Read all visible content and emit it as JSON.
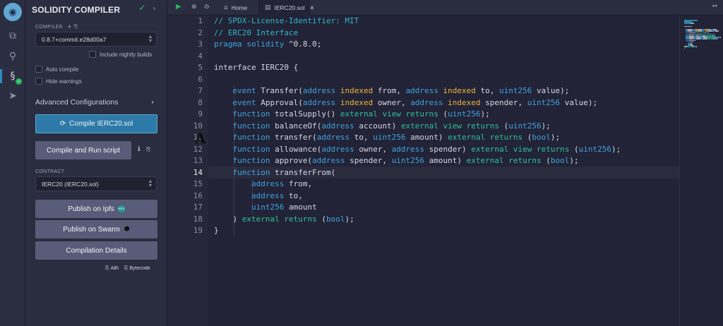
{
  "rail": {
    "icons": [
      "remix-logo-icon",
      "file-explorer-icon",
      "search-icon",
      "solidity-compiler-icon",
      "deploy-run-icon"
    ]
  },
  "panel": {
    "title": "SOLIDITY COMPILER",
    "compiler_label": "COMPILER",
    "compiler_version": "0.8.7+commit.e28d00a7",
    "include_nightly": "Include nightly builds",
    "auto_compile": "Auto compile",
    "hide_warnings": "Hide warnings",
    "advanced": "Advanced Configurations",
    "compile_button": "Compile IERC20.sol",
    "compile_run_button": "Compile and Run script",
    "contract_label": "CONTRACT",
    "contract_value": "IERC20 (IERC20.sol)",
    "publish_ipfs": "Publish on Ipfs",
    "ipfs_badge": "IPFS",
    "publish_swarm": "Publish on Swarm",
    "compilation_details": "Compilation Details",
    "abi_link": "ABI",
    "bytecode_link": "Bytecode"
  },
  "tabs": {
    "home": "Home",
    "file": "IERC20.sol"
  },
  "figure_letter": "A",
  "editor": {
    "current_line": 14,
    "line_numbers": [
      "1",
      "2",
      "3",
      "4",
      "5",
      "6",
      "7",
      "8",
      "9",
      "10",
      "11",
      "12",
      "13",
      "14",
      "15",
      "16",
      "17",
      "18",
      "19"
    ],
    "colors": {
      "comment": "#2fb6c7",
      "keyword": "#3fa3e0",
      "modifier": "#2fc19b",
      "indexed": "#e8b63e",
      "plain": "#d5d7e2"
    },
    "lines": [
      [
        {
          "t": "// SPDX-License-Identifier: MIT",
          "c": "com"
        }
      ],
      [
        {
          "t": "// ERC20 Interface",
          "c": "com"
        }
      ],
      [
        {
          "t": "pragma solidity",
          "c": "kw"
        },
        {
          "t": " ^0.8.0;",
          "c": "pl"
        }
      ],
      [],
      [
        {
          "t": "interface IERC20 {",
          "c": "pl"
        }
      ],
      [],
      [
        {
          "t": "    ",
          "c": "pl"
        },
        {
          "t": "event",
          "c": "kw"
        },
        {
          "t": " Transfer(",
          "c": "pl"
        },
        {
          "t": "address",
          "c": "kw"
        },
        {
          "t": " ",
          "c": "pl"
        },
        {
          "t": "indexed",
          "c": "idx"
        },
        {
          "t": " from, ",
          "c": "pl"
        },
        {
          "t": "address",
          "c": "kw"
        },
        {
          "t": " ",
          "c": "pl"
        },
        {
          "t": "indexed",
          "c": "idx"
        },
        {
          "t": " to, ",
          "c": "pl"
        },
        {
          "t": "uint256",
          "c": "kw"
        },
        {
          "t": " value);",
          "c": "pl"
        }
      ],
      [
        {
          "t": "    ",
          "c": "pl"
        },
        {
          "t": "event",
          "c": "kw"
        },
        {
          "t": " Approval(",
          "c": "pl"
        },
        {
          "t": "address",
          "c": "kw"
        },
        {
          "t": " ",
          "c": "pl"
        },
        {
          "t": "indexed",
          "c": "idx"
        },
        {
          "t": " owner, ",
          "c": "pl"
        },
        {
          "t": "address",
          "c": "kw"
        },
        {
          "t": " ",
          "c": "pl"
        },
        {
          "t": "indexed",
          "c": "idx"
        },
        {
          "t": " spender, ",
          "c": "pl"
        },
        {
          "t": "uint256",
          "c": "kw"
        },
        {
          "t": " value);",
          "c": "pl"
        }
      ],
      [
        {
          "t": "    ",
          "c": "pl"
        },
        {
          "t": "function",
          "c": "kw"
        },
        {
          "t": " totalSupply() ",
          "c": "pl"
        },
        {
          "t": "external",
          "c": "ext"
        },
        {
          "t": " ",
          "c": "pl"
        },
        {
          "t": "view",
          "c": "ext"
        },
        {
          "t": " ",
          "c": "pl"
        },
        {
          "t": "returns",
          "c": "ext"
        },
        {
          "t": " (",
          "c": "pl"
        },
        {
          "t": "uint256",
          "c": "kw"
        },
        {
          "t": ");",
          "c": "pl"
        }
      ],
      [
        {
          "t": "    ",
          "c": "pl"
        },
        {
          "t": "function",
          "c": "kw"
        },
        {
          "t": " balanceOf(",
          "c": "pl"
        },
        {
          "t": "address",
          "c": "kw"
        },
        {
          "t": " account) ",
          "c": "pl"
        },
        {
          "t": "external",
          "c": "ext"
        },
        {
          "t": " ",
          "c": "pl"
        },
        {
          "t": "view",
          "c": "ext"
        },
        {
          "t": " ",
          "c": "pl"
        },
        {
          "t": "returns",
          "c": "ext"
        },
        {
          "t": " (",
          "c": "pl"
        },
        {
          "t": "uint256",
          "c": "kw"
        },
        {
          "t": ");",
          "c": "pl"
        }
      ],
      [
        {
          "t": "    ",
          "c": "pl"
        },
        {
          "t": "function",
          "c": "kw"
        },
        {
          "t": " transfer(",
          "c": "pl"
        },
        {
          "t": "address",
          "c": "kw"
        },
        {
          "t": " to, ",
          "c": "pl"
        },
        {
          "t": "uint256",
          "c": "kw"
        },
        {
          "t": " amount) ",
          "c": "pl"
        },
        {
          "t": "external",
          "c": "ext"
        },
        {
          "t": " ",
          "c": "pl"
        },
        {
          "t": "returns",
          "c": "ext"
        },
        {
          "t": " (",
          "c": "pl"
        },
        {
          "t": "bool",
          "c": "kw"
        },
        {
          "t": ");",
          "c": "pl"
        }
      ],
      [
        {
          "t": "    ",
          "c": "pl"
        },
        {
          "t": "function",
          "c": "kw"
        },
        {
          "t": " allowance(",
          "c": "pl"
        },
        {
          "t": "address",
          "c": "kw"
        },
        {
          "t": " owner, ",
          "c": "pl"
        },
        {
          "t": "address",
          "c": "kw"
        },
        {
          "t": " spender) ",
          "c": "pl"
        },
        {
          "t": "external",
          "c": "ext"
        },
        {
          "t": " ",
          "c": "pl"
        },
        {
          "t": "view",
          "c": "ext"
        },
        {
          "t": " ",
          "c": "pl"
        },
        {
          "t": "returns",
          "c": "ext"
        },
        {
          "t": " (",
          "c": "pl"
        },
        {
          "t": "uint256",
          "c": "kw"
        },
        {
          "t": ");",
          "c": "pl"
        }
      ],
      [
        {
          "t": "    ",
          "c": "pl"
        },
        {
          "t": "function",
          "c": "kw"
        },
        {
          "t": " approve(",
          "c": "pl"
        },
        {
          "t": "address",
          "c": "kw"
        },
        {
          "t": " spender, ",
          "c": "pl"
        },
        {
          "t": "uint256",
          "c": "kw"
        },
        {
          "t": " amount) ",
          "c": "pl"
        },
        {
          "t": "external",
          "c": "ext"
        },
        {
          "t": " ",
          "c": "pl"
        },
        {
          "t": "returns",
          "c": "ext"
        },
        {
          "t": " (",
          "c": "pl"
        },
        {
          "t": "bool",
          "c": "kw"
        },
        {
          "t": ");",
          "c": "pl"
        }
      ],
      [
        {
          "t": "    ",
          "c": "pl"
        },
        {
          "t": "function",
          "c": "kw"
        },
        {
          "t": " transferFrom(",
          "c": "pl"
        }
      ],
      [
        {
          "t": "        ",
          "c": "pl"
        },
        {
          "t": "address",
          "c": "kw"
        },
        {
          "t": " from,",
          "c": "pl"
        }
      ],
      [
        {
          "t": "        ",
          "c": "pl"
        },
        {
          "t": "address",
          "c": "kw"
        },
        {
          "t": " to,",
          "c": "pl"
        }
      ],
      [
        {
          "t": "        ",
          "c": "pl"
        },
        {
          "t": "uint256",
          "c": "kw"
        },
        {
          "t": " amount",
          "c": "pl"
        }
      ],
      [
        {
          "t": "    ) ",
          "c": "pl"
        },
        {
          "t": "external",
          "c": "ext"
        },
        {
          "t": " ",
          "c": "pl"
        },
        {
          "t": "returns",
          "c": "ext"
        },
        {
          "t": " (",
          "c": "pl"
        },
        {
          "t": "bool",
          "c": "kw"
        },
        {
          "t": ");",
          "c": "pl"
        }
      ],
      [
        {
          "t": "}",
          "c": "pl"
        }
      ]
    ]
  }
}
